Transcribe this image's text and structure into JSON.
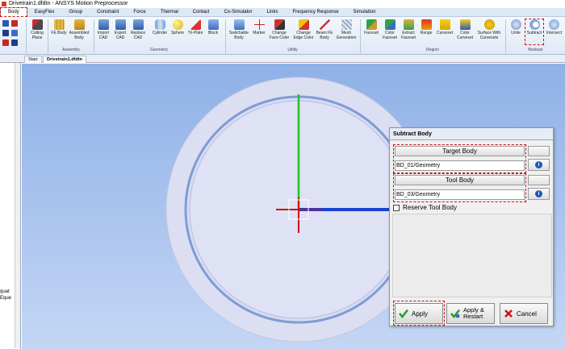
{
  "window": {
    "title": "Drivetrain1.dfdtn - ANSYS Motion Preprocessor"
  },
  "menu": [
    "Body",
    "EasyFlex",
    "Group",
    "Constraint",
    "Force",
    "Thermal",
    "Contact",
    "Co-Simulator",
    "Links",
    "Frequency Response",
    "Simulation"
  ],
  "ribbon": {
    "buttons": {
      "cutting_plane": "Cutting Plane",
      "fe_body": "FE Body",
      "assembled_body": "Assembled Body",
      "import_cad": "Import CAD",
      "export_cad": "Export CAD",
      "replace_cad": "Replace CAD",
      "cylinder": "Cylinder",
      "sphere": "Sphere",
      "tri_plate": "Tri-Plate",
      "block": "Block",
      "switchable_body": "Switchable Body",
      "marker": "Marker",
      "change_face_color": "Change Face Color",
      "change_edge_color": "Change Edge Color",
      "beam_fe_body": "Beam FE Body",
      "mesh_generation": "Mesh Generation",
      "faceset": "Faceset",
      "color_faceset": "Color Faceset",
      "extract_faceset": "Extract Faceset",
      "range": "Range",
      "curveset": "Curveset",
      "color_curveset": "Color Curveset",
      "surface_with_curvesets": "Surface With Curvesets",
      "unite": "Unite",
      "subtract": "Subtract",
      "intersect": "Intersect"
    },
    "groups": {
      "assembly": "Assembly",
      "geometry": "Geometry",
      "utility": "Utility",
      "region": "Region",
      "boolean": "Boolean"
    }
  },
  "tabs": {
    "start": "Start",
    "document": "Drivetrain1.dfdtn"
  },
  "left_panel": {
    "line1": "quat",
    "line2": "Eque"
  },
  "dialog": {
    "title": "Subtract Body",
    "target_header": "Target Body",
    "target_value": "BD_01/Geometry",
    "tool_header": "Tool Body",
    "tool_value": "BD_03/Geometry",
    "reserve_label": "Reserve Tool Body",
    "apply": "Apply",
    "apply_restart": "Apply & Restart",
    "cancel": "Cancel"
  }
}
